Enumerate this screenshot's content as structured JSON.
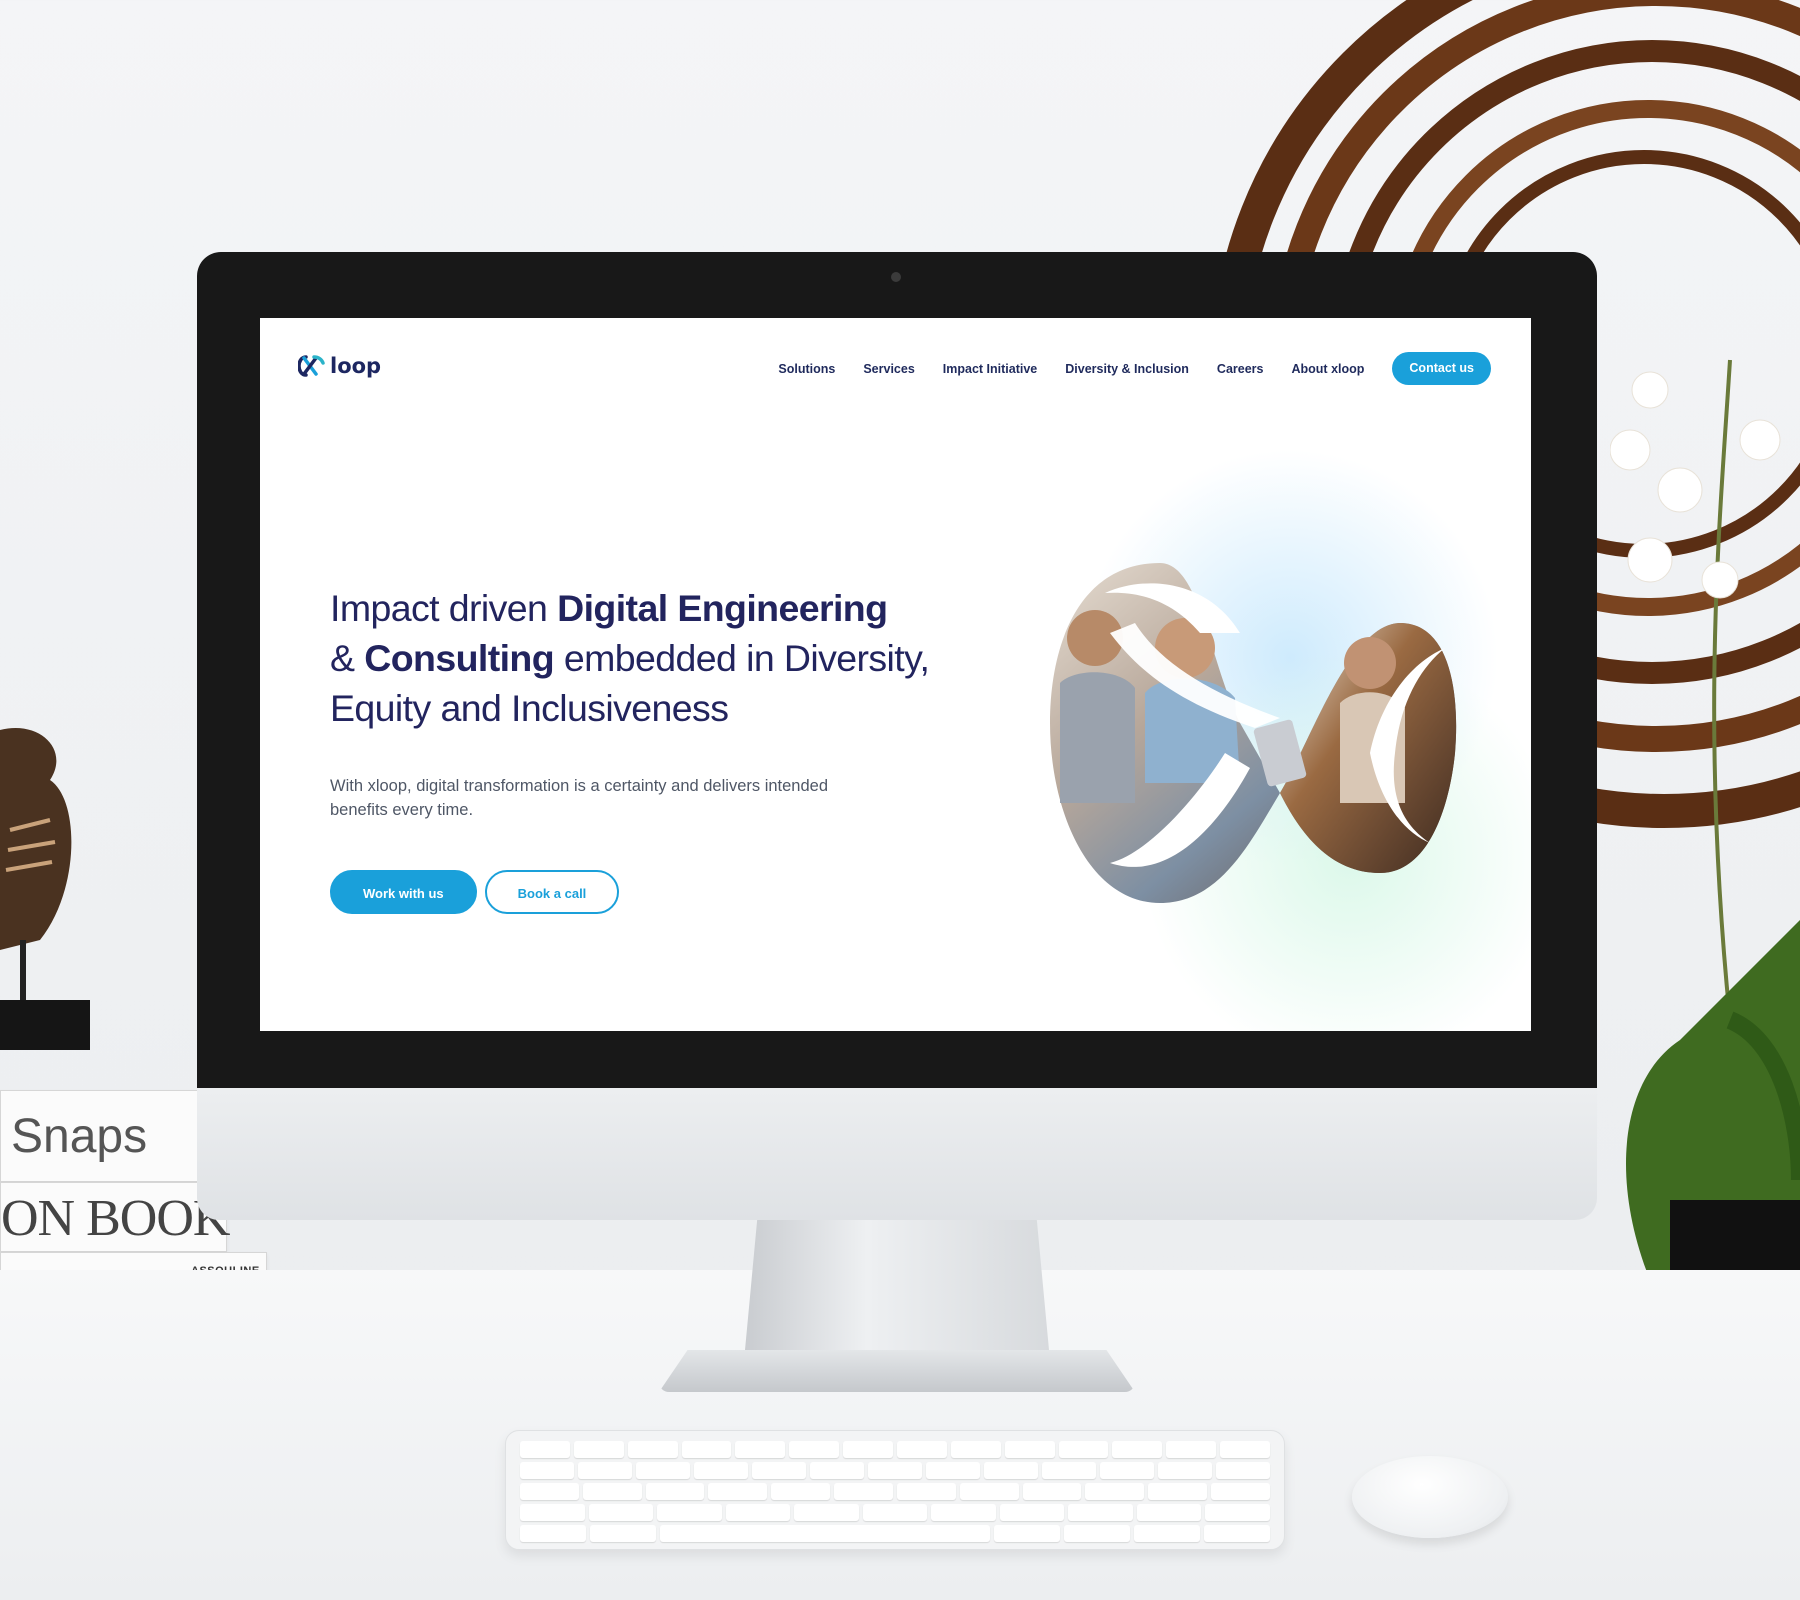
{
  "brand": {
    "name": "loop",
    "primary": "#1aa0da",
    "heading_color": "#22245e"
  },
  "nav": {
    "links": [
      "Solutions",
      "Services",
      "Impact Initiative",
      "Diversity & Inclusion",
      "Careers",
      "About xloop"
    ],
    "cta": "Contact us"
  },
  "hero": {
    "title_1": "Impact driven ",
    "title_bold_1": "Digital Engineering",
    "title_2": "& ",
    "title_bold_2": "Consulting",
    "title_3": " embedded in Diversity, Equity and Inclusiveness",
    "subtitle": "With xloop, digital transformation is a certainty and delivers intended benefits every time.",
    "primary_button": "Work with us",
    "secondary_button": "Book a call"
  },
  "scene": {
    "book_1_title": "Snaps",
    "book_2_title": "ON BOOK",
    "publisher": "ASSOULINE"
  },
  "icons": [
    "xloop-logo-icon",
    "infinity-photo-graphic"
  ]
}
